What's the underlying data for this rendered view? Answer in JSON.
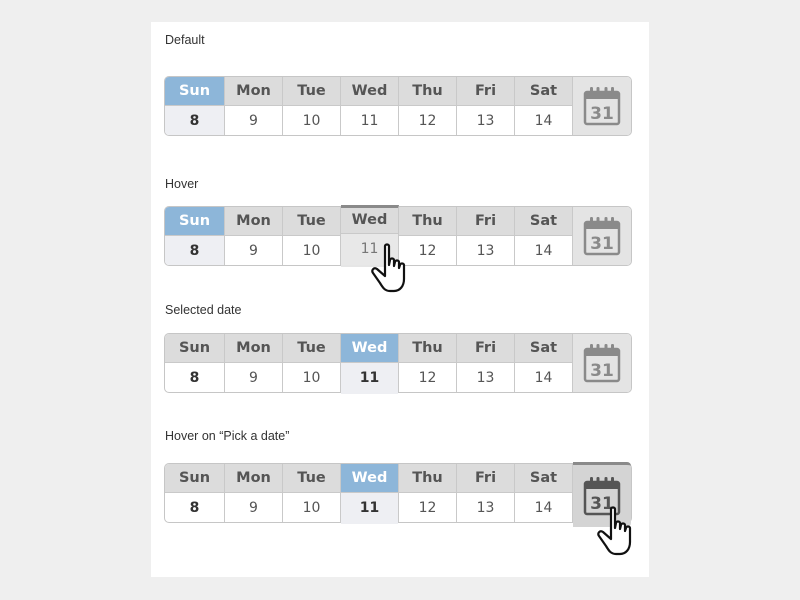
{
  "sections": [
    {
      "label": "Default",
      "days": [
        {
          "name": "Sun",
          "date": "8"
        },
        {
          "name": "Mon",
          "date": "9"
        },
        {
          "name": "Tue",
          "date": "10"
        },
        {
          "name": "Wed",
          "date": "11"
        },
        {
          "name": "Thu",
          "date": "12"
        },
        {
          "name": "Fri",
          "date": "13"
        },
        {
          "name": "Sat",
          "date": "14"
        }
      ],
      "picker_icon_text": "31"
    },
    {
      "label": "Hover",
      "days": [
        {
          "name": "Sun",
          "date": "8"
        },
        {
          "name": "Mon",
          "date": "9"
        },
        {
          "name": "Tue",
          "date": "10"
        },
        {
          "name": "Wed",
          "date": "11"
        },
        {
          "name": "Thu",
          "date": "12"
        },
        {
          "name": "Fri",
          "date": "13"
        },
        {
          "name": "Sat",
          "date": "14"
        }
      ],
      "picker_icon_text": "31"
    },
    {
      "label": "Selected date",
      "days": [
        {
          "name": "Sun",
          "date": "8"
        },
        {
          "name": "Mon",
          "date": "9"
        },
        {
          "name": "Tue",
          "date": "10"
        },
        {
          "name": "Wed",
          "date": "11"
        },
        {
          "name": "Thu",
          "date": "12"
        },
        {
          "name": "Fri",
          "date": "13"
        },
        {
          "name": "Sat",
          "date": "14"
        }
      ],
      "picker_icon_text": "31"
    },
    {
      "label": "Hover on “Pick a date”",
      "days": [
        {
          "name": "Sun",
          "date": "8"
        },
        {
          "name": "Mon",
          "date": "9"
        },
        {
          "name": "Tue",
          "date": "10"
        },
        {
          "name": "Wed",
          "date": "11"
        },
        {
          "name": "Thu",
          "date": "12"
        },
        {
          "name": "Fri",
          "date": "13"
        },
        {
          "name": "Sat",
          "date": "14"
        }
      ],
      "picker_icon_text": "31"
    }
  ],
  "colors": {
    "accent": "#8db6d9",
    "header_bg": "#dcdcdc",
    "picker_bg": "#e4e4e4"
  }
}
